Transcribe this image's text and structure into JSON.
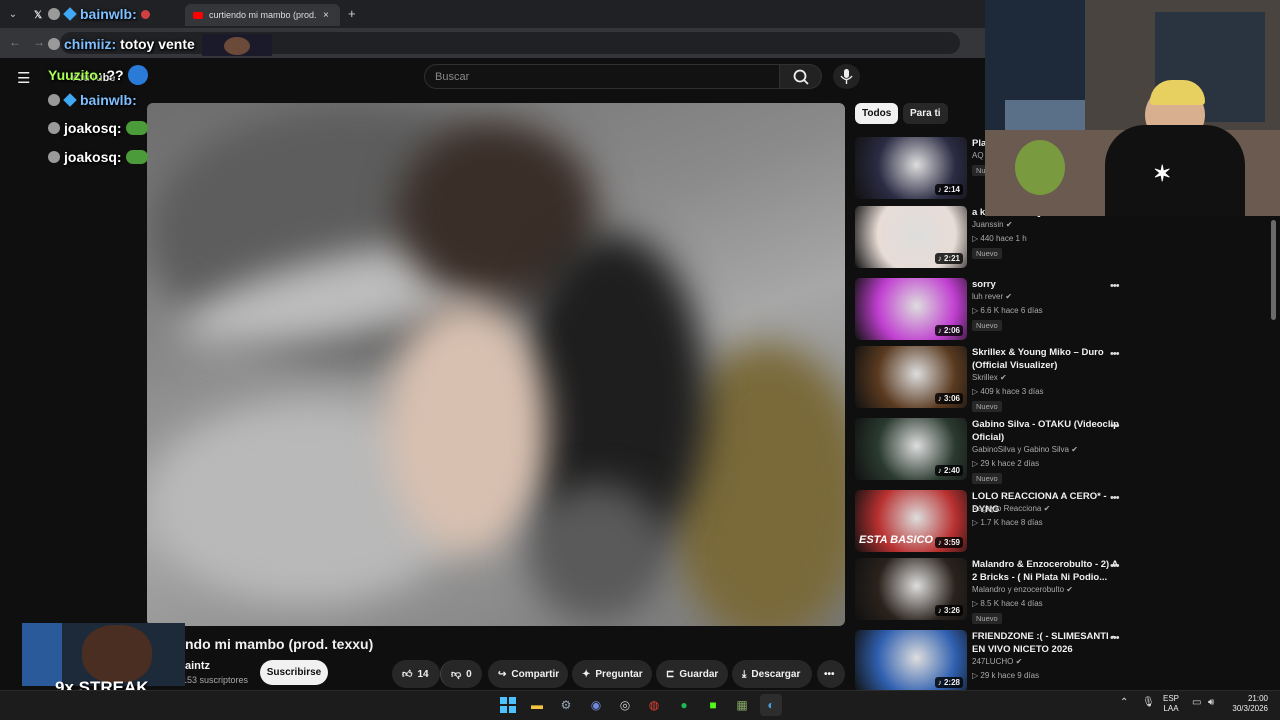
{
  "browser": {
    "tabs": [
      {
        "label": "",
        "icon": "x-logo-icon"
      },
      {
        "label": "curtiendo mi mambo (prod. tex",
        "icon": "youtube-icon"
      }
    ],
    "new_tab": "+",
    "address_text": "chimiiz: totoy vente"
  },
  "youtube": {
    "logo": "YouTube",
    "search_placeholder": "Buscar"
  },
  "chat": [
    {
      "user": "bainwlb:",
      "text": ""
    },
    {
      "user": "chimiiz:",
      "text": "totoy vente"
    },
    {
      "user": "Yuuzito:",
      "text": "??"
    },
    {
      "user": "bainwlb:",
      "text": ""
    },
    {
      "user": "joakosq:",
      "text": ""
    },
    {
      "user": "joakosq:",
      "text": ""
    }
  ],
  "video": {
    "title": "ndo mi mambo (prod. texxu)",
    "channel": "aintz",
    "subscribers": "153 suscriptores",
    "subscribe_label": "Suscribirse",
    "likes": "14",
    "dislikes": "0",
    "share_label": "Compartir",
    "ask_label": "Preguntar",
    "save_label": "Guardar",
    "download_label": "Descargar"
  },
  "chips": [
    "Todos",
    "Para ti"
  ],
  "recommendations": [
    {
      "title": "Pla",
      "channel": "AQ",
      "meta": "",
      "badge": "Nu",
      "duration": "2:14",
      "color": "#2b2b44"
    },
    {
      "title": "a k laconexion]",
      "channel": "Juanssin",
      "meta": "440  hace 1 h",
      "badge": "Nuevo",
      "duration": "2:21",
      "color": "#e8dcd6"
    },
    {
      "title": "sorry",
      "channel": "luh rever",
      "meta": "6.6 K  hace 6 días",
      "badge": "Nuevo",
      "duration": "2:06",
      "color": "#c03fd0"
    },
    {
      "title": "Skrillex & Young Miko – Duro (Official Visualizer)",
      "channel": "Skrillex",
      "meta": "409 k  hace 3 días",
      "badge": "Nuevo",
      "duration": "3:06",
      "color": "#5a3a20"
    },
    {
      "title": "Gabino Silva - OTAKU (Videoclip Oficial)",
      "channel": "GabinoSilva  y Gabino Silva",
      "meta": "29 k  hace 2 días",
      "badge": "Nuevo",
      "duration": "2:40",
      "color": "#2a3a30"
    },
    {
      "title": "LOLO REACCIONA A CERO* - DYNG",
      "channel": "Rageylo Reacciona",
      "meta": "1.7 K  hace 8 días",
      "badge": "",
      "duration": "3:59",
      "color": "#b83030",
      "thumb_text": "ESTA BASICO"
    },
    {
      "title": "Malandro & Enzocerobulto - 2) A 2 Bricks - ( Ni Plata Ni Podio...",
      "channel": "Malandro  y enzocerobulto",
      "meta": "8.5 K  hace 4 días",
      "badge": "Nuevo",
      "duration": "3:26",
      "color": "#2a221c"
    },
    {
      "title": "FRIENDZONE :( - SLIMESANTI - EN VIVO NICETO 2026",
      "channel": "247LUCHO",
      "meta": "29 k  hace 9 días",
      "badge": "",
      "duration": "2:28",
      "color": "#3060b0"
    }
  ],
  "overlay": {
    "streak": "9x STREAK"
  },
  "tray": {
    "lang1": "ESP",
    "lang2": "LAA",
    "time": "21:00",
    "date": "30/3/2026"
  }
}
